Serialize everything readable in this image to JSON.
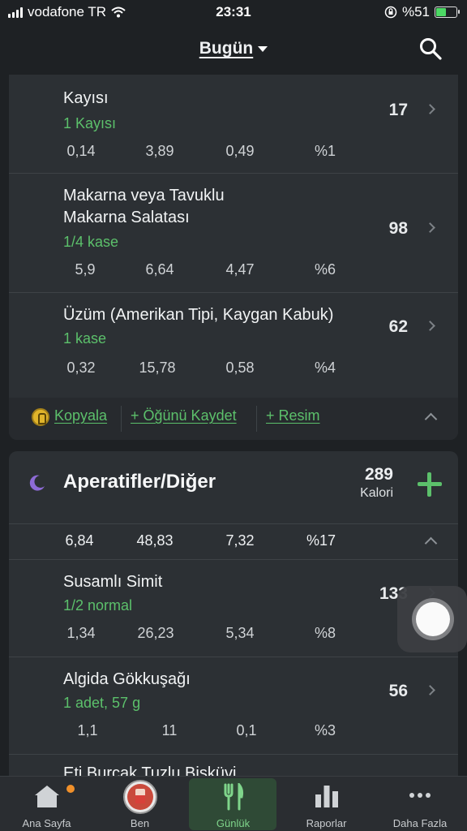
{
  "status": {
    "carrier": "vodafone TR",
    "time": "23:31",
    "battery": "%51"
  },
  "header": {
    "title": "Bugün"
  },
  "card1": {
    "foods": [
      {
        "name_lines": [
          "Kayısı"
        ],
        "serving": "1 Kayısı",
        "kcal": "17",
        "macros": [
          "0,14",
          "3,89",
          "0,49",
          "%1"
        ]
      },
      {
        "name_lines": [
          "Makarna veya Tavuklu",
          "Makarna Salatası"
        ],
        "serving": "1/4 kase",
        "kcal": "98",
        "macros": [
          "5,9",
          "6,64",
          "4,47",
          "%6"
        ]
      },
      {
        "name_lines": [
          "Üzüm (Amerikan Tipi, Kaygan Kabuk)"
        ],
        "serving": "1 kase",
        "kcal": "62",
        "macros": [
          "0,32",
          "15,78",
          "0,58",
          "%4"
        ]
      }
    ],
    "actions": {
      "copy": "Kopyala",
      "save_meal": "+ Öğünü Kaydet",
      "photo": "+ Resim"
    }
  },
  "meal2": {
    "title": "Aperatifler/Diğer",
    "kcal": "289",
    "kcal_label": "Kalori",
    "totals": [
      "6,84",
      "48,83",
      "7,32",
      "%17"
    ],
    "foods": [
      {
        "name": "Susamlı Simit",
        "serving": "1/2 normal",
        "kcal": "133",
        "macros": [
          "1,34",
          "26,23",
          "5,34",
          "%8"
        ]
      },
      {
        "name": "Algida Gökkuşağı",
        "serving": "1 adet, 57 g",
        "kcal": "56",
        "macros": [
          "1,1",
          "11",
          "0,1",
          "%3"
        ]
      },
      {
        "name": "Eti Burçak Tuzlu Bisküvi",
        "serving": "",
        "kcal": "",
        "macros": []
      }
    ]
  },
  "tabs": [
    {
      "label": "Ana Sayfa",
      "icon": "home-icon"
    },
    {
      "label": "Ben",
      "icon": "avatar-icon"
    },
    {
      "label": "Günlük",
      "icon": "fork-knife-icon"
    },
    {
      "label": "Raporlar",
      "icon": "bar-chart-icon"
    },
    {
      "label": "Daha Fazla",
      "icon": "more-icon"
    }
  ],
  "colors": {
    "accent_green": "#5cc06b",
    "badge_orange": "#f0902a",
    "moon_purple": "#8d6bd6"
  }
}
